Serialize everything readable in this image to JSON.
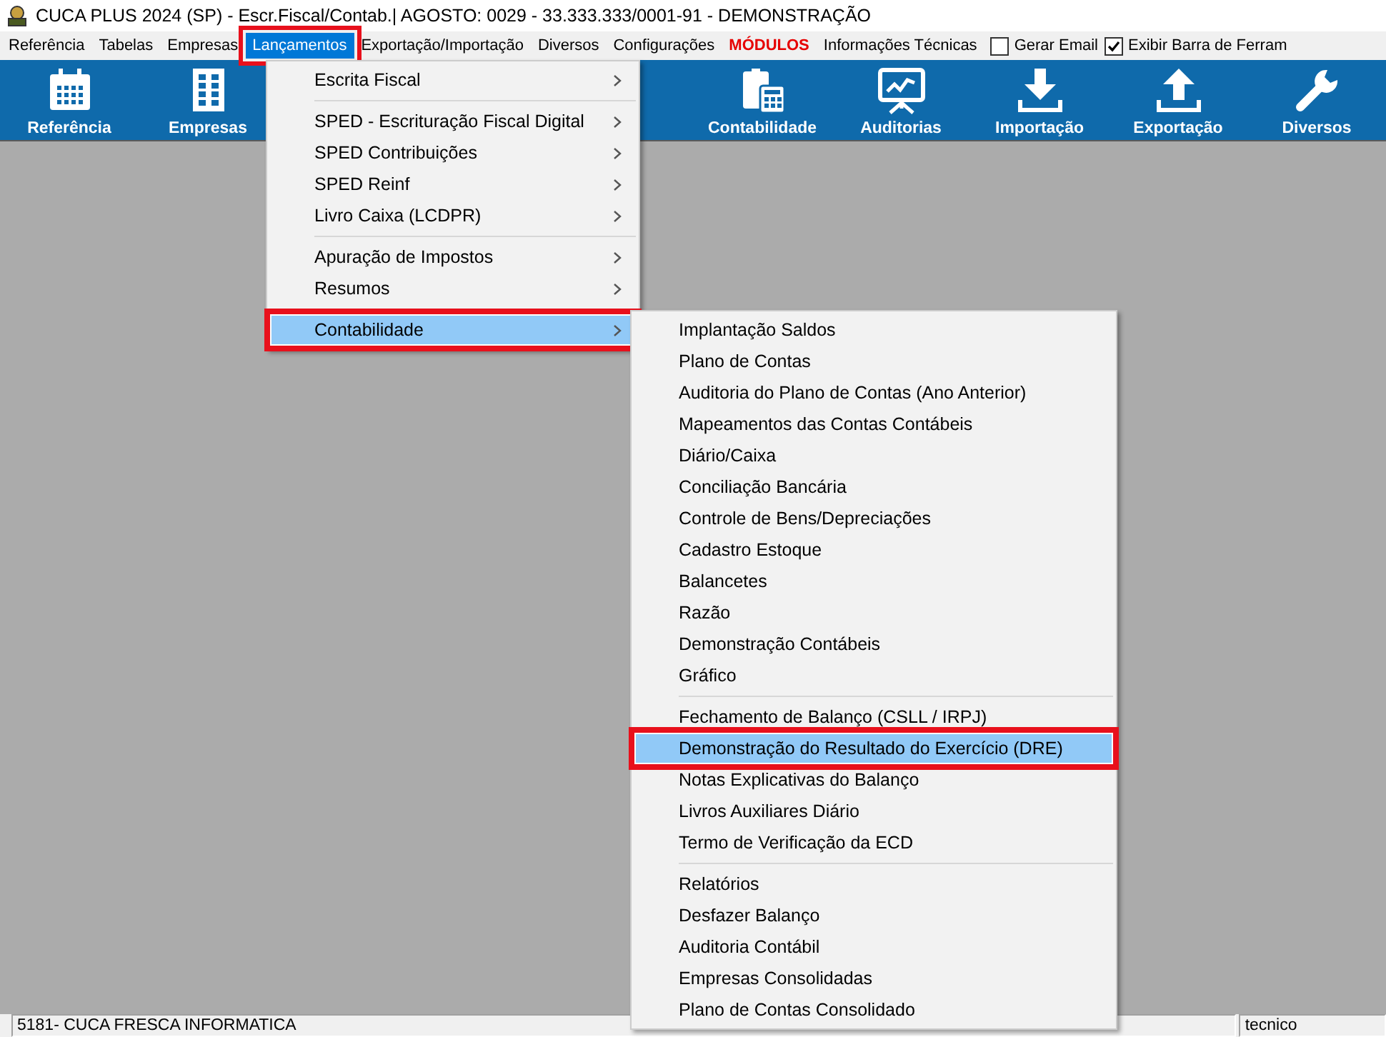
{
  "window": {
    "title": "CUCA PLUS 2024 (SP) - Escr.Fiscal/Contab.| AGOSTO: 0029 - 33.333.333/0001-91 - DEMONSTRAÇÃO"
  },
  "menubar": [
    {
      "kind": "menu",
      "label": "Referência",
      "selected": false,
      "annotated": false
    },
    {
      "kind": "menu",
      "label": "Tabelas",
      "selected": false,
      "annotated": false
    },
    {
      "kind": "menu",
      "label": "Empresas",
      "selected": false,
      "annotated": false
    },
    {
      "kind": "menu",
      "label": "Lançamentos",
      "selected": true,
      "annotated": true
    },
    {
      "kind": "menu",
      "label": "Exportação/Importação",
      "selected": false,
      "annotated": false
    },
    {
      "kind": "menu",
      "label": "Diversos",
      "selected": false,
      "annotated": false
    },
    {
      "kind": "menu",
      "label": "Configurações",
      "selected": false,
      "annotated": false
    },
    {
      "kind": "modules",
      "label": "MÓDULOS",
      "selected": false,
      "annotated": false
    },
    {
      "kind": "menu",
      "label": "Informações Técnicas",
      "selected": false,
      "annotated": false
    },
    {
      "kind": "checkbox",
      "label": "Gerar Email",
      "checked": false
    },
    {
      "kind": "checkbox",
      "label": "Exibir Barra de Ferram",
      "checked": true
    }
  ],
  "toolbar": [
    {
      "kind": "calendar",
      "label": "Referência"
    },
    {
      "kind": "building",
      "label": "Empresas"
    },
    {
      "kind": "hidden"
    },
    {
      "kind": "hidden"
    },
    {
      "kind": "hidden"
    },
    {
      "kind": "calculator",
      "label": "Contabilidade"
    },
    {
      "kind": "chart",
      "label": "Auditorias"
    },
    {
      "kind": "download",
      "label": "Importação"
    },
    {
      "kind": "upload",
      "label": "Exportação"
    },
    {
      "kind": "wrench",
      "label": "Diversos"
    }
  ],
  "menu": {
    "groups": [
      [
        {
          "label": "Escrita Fiscal",
          "submenu": true,
          "selected": false,
          "annotated": false
        }
      ],
      [
        {
          "label": "SPED - Escrituração Fiscal Digital",
          "submenu": true,
          "selected": false,
          "annotated": false
        },
        {
          "label": "SPED Contribuições",
          "submenu": true,
          "selected": false,
          "annotated": false
        },
        {
          "label": "SPED Reinf",
          "submenu": true,
          "selected": false,
          "annotated": false
        },
        {
          "label": "Livro Caixa (LCDPR)",
          "submenu": true,
          "selected": false,
          "annotated": false
        }
      ],
      [
        {
          "label": "Apuração de Impostos",
          "submenu": true,
          "selected": false,
          "annotated": false
        },
        {
          "label": "Resumos",
          "submenu": true,
          "selected": false,
          "annotated": false
        }
      ],
      [
        {
          "label": "Contabilidade",
          "submenu": true,
          "selected": true,
          "annotated": true
        }
      ]
    ]
  },
  "submenu": {
    "groups": [
      [
        {
          "label": "Implantação Saldos",
          "selected": false,
          "annotated": false
        },
        {
          "label": "Plano de Contas",
          "selected": false,
          "annotated": false
        },
        {
          "label": "Auditoria do Plano de Contas (Ano Anterior)",
          "selected": false,
          "annotated": false
        },
        {
          "label": "Mapeamentos das Contas Contábeis",
          "selected": false,
          "annotated": false
        },
        {
          "label": "Diário/Caixa",
          "selected": false,
          "annotated": false
        },
        {
          "label": "Conciliação Bancária",
          "selected": false,
          "annotated": false
        },
        {
          "label": "Controle de Bens/Depreciações",
          "selected": false,
          "annotated": false
        },
        {
          "label": "Cadastro Estoque",
          "selected": false,
          "annotated": false
        },
        {
          "label": "Balancetes",
          "selected": false,
          "annotated": false
        },
        {
          "label": "Razão",
          "selected": false,
          "annotated": false
        },
        {
          "label": "Demonstração Contábeis",
          "selected": false,
          "annotated": false
        },
        {
          "label": "Gráfico",
          "selected": false,
          "annotated": false
        }
      ],
      [
        {
          "label": "Fechamento de Balanço (CSLL / IRPJ)",
          "selected": false,
          "annotated": false
        },
        {
          "label": "Demonstração do Resultado do Exercício (DRE)",
          "selected": true,
          "annotated": true
        },
        {
          "label": "Notas Explicativas do Balanço",
          "selected": false,
          "annotated": false
        },
        {
          "label": "Livros Auxiliares Diário",
          "selected": false,
          "annotated": false
        },
        {
          "label": "Termo de Verificação da ECD",
          "selected": false,
          "annotated": false
        }
      ],
      [
        {
          "label": "Relatórios",
          "selected": false,
          "annotated": false
        },
        {
          "label": "Desfazer Balanço",
          "selected": false,
          "annotated": false
        },
        {
          "label": "Auditoria Contábil",
          "selected": false,
          "annotated": false
        },
        {
          "label": "Empresas Consolidadas",
          "selected": false,
          "annotated": false
        },
        {
          "label": "Plano de Contas Consolidado",
          "selected": false,
          "annotated": false
        }
      ]
    ]
  },
  "status_bar": {
    "company": "5181- CUCA FRESCA INFORMATICA",
    "user": "tecnico"
  }
}
